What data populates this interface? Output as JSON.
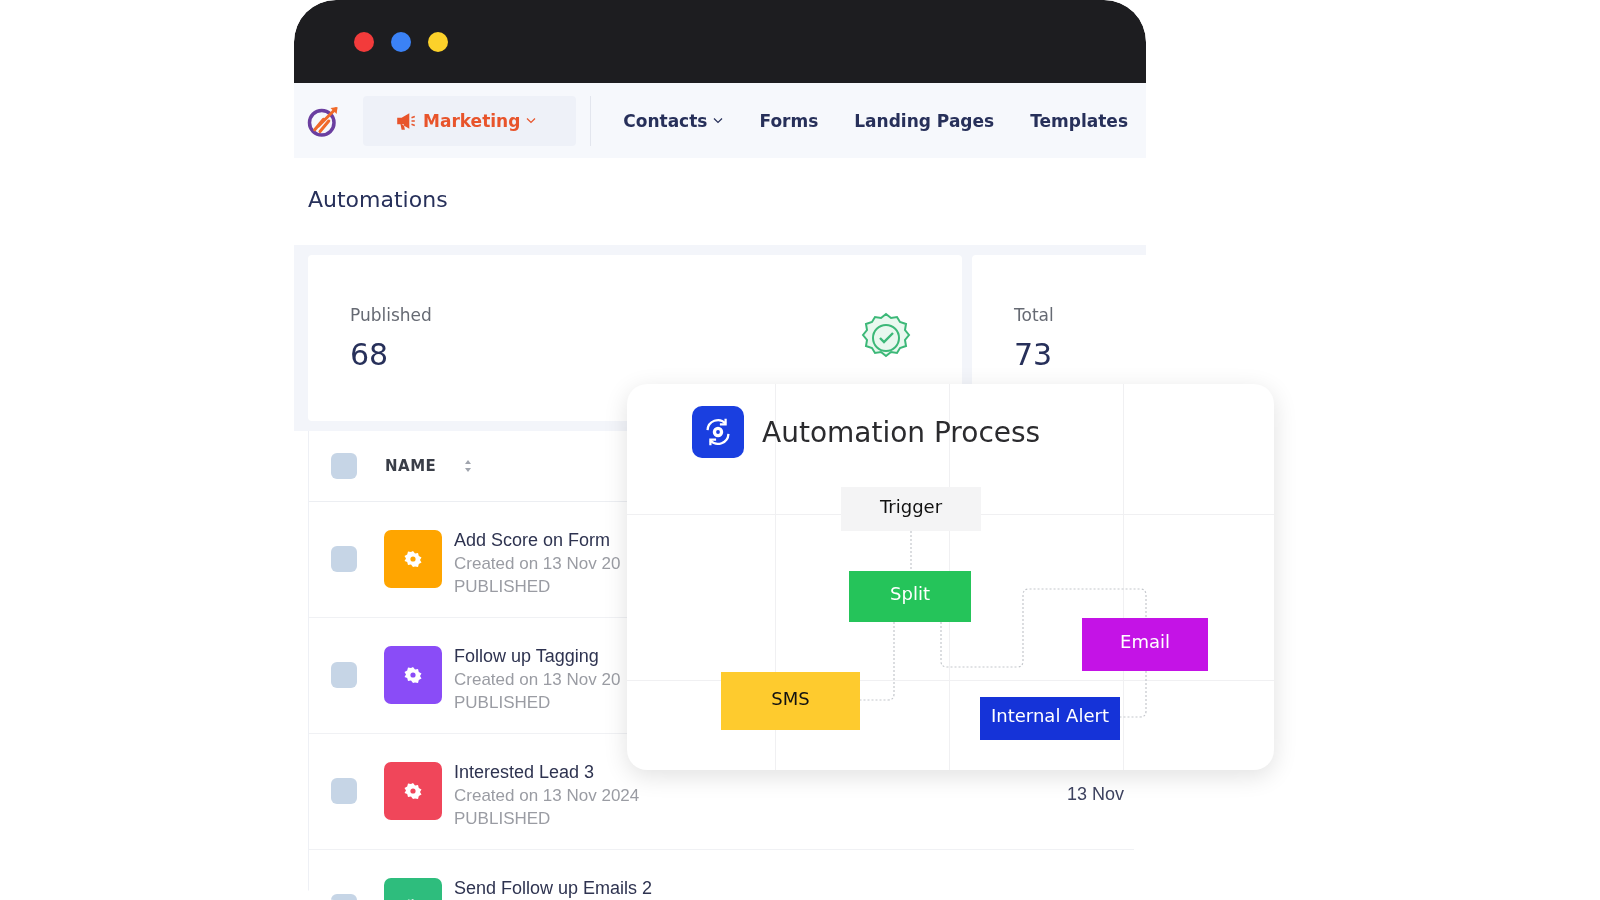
{
  "nav": {
    "items": [
      {
        "label": "Marketing",
        "selected": true,
        "dropdown": true
      },
      {
        "label": "Contacts",
        "selected": false,
        "dropdown": true
      },
      {
        "label": "Forms",
        "selected": false,
        "dropdown": false
      },
      {
        "label": "Landing Pages",
        "selected": false,
        "dropdown": false
      },
      {
        "label": "Templates",
        "selected": false,
        "dropdown": false
      }
    ]
  },
  "page_title": "Automations",
  "stats": [
    {
      "label": "Published",
      "value": "68",
      "kind": "badge"
    },
    {
      "label": "Total",
      "value": "73",
      "kind": "plain"
    }
  ],
  "table": {
    "header": {
      "label": "NAME",
      "checked": false
    },
    "rows": [
      {
        "name": "Add Score on Form",
        "created": "Created on 13 Nov 20",
        "status": "PUBLISHED",
        "color": "#ffa500",
        "checked": false
      },
      {
        "name": "Follow up Tagging",
        "created": "Created on 13 Nov 20",
        "status": "PUBLISHED",
        "color": "#8a4cf7",
        "checked": false
      },
      {
        "name": "Interested Lead 3",
        "created": "Created on 13 Nov 2024",
        "status": "PUBLISHED",
        "date": "13 Nov",
        "color": "#f0465a",
        "checked": false
      },
      {
        "name": "Send Follow up Emails 2",
        "color": "#2ebd7d",
        "checked": false
      }
    ]
  },
  "process": {
    "title": "Automation Process",
    "nodes": [
      {
        "label": "Trigger",
        "color": "#f4f4f5"
      },
      {
        "label": "Split",
        "color": "#25c45a"
      },
      {
        "label": "Email",
        "color": "#c413e6"
      },
      {
        "label": "SMS",
        "color": "#fecb2e"
      },
      {
        "label": "Internal Alert",
        "color": "#1533d8"
      }
    ]
  }
}
